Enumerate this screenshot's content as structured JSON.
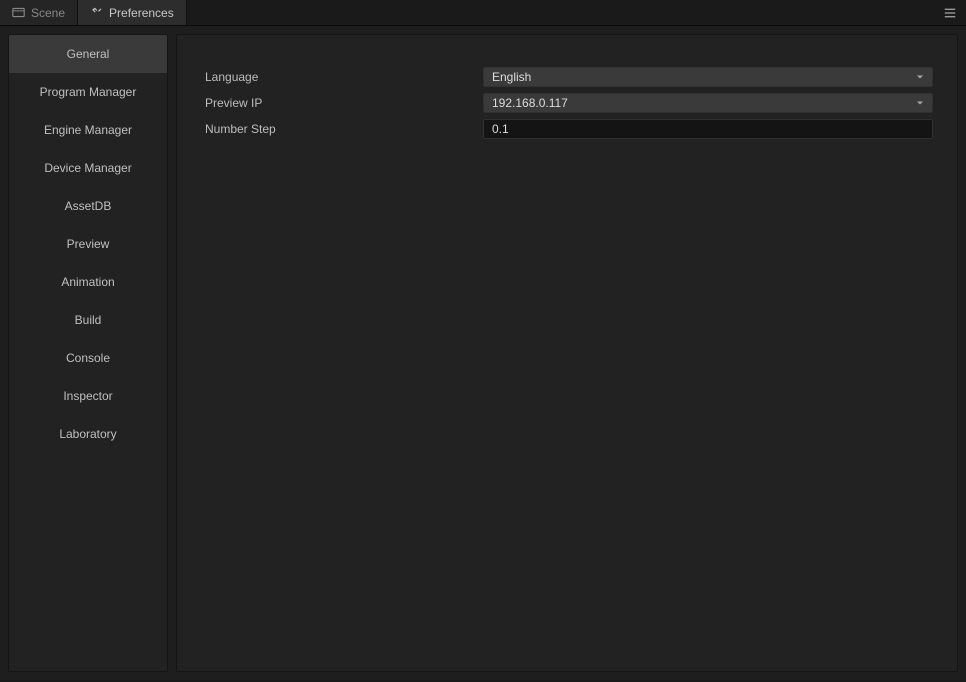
{
  "tabs": {
    "scene": {
      "label": "Scene"
    },
    "preferences": {
      "label": "Preferences"
    }
  },
  "sidebar": {
    "items": [
      {
        "label": "General",
        "selected": true
      },
      {
        "label": "Program Manager"
      },
      {
        "label": "Engine Manager"
      },
      {
        "label": "Device Manager"
      },
      {
        "label": "AssetDB"
      },
      {
        "label": "Preview"
      },
      {
        "label": "Animation"
      },
      {
        "label": "Build"
      },
      {
        "label": "Console"
      },
      {
        "label": "Inspector"
      },
      {
        "label": "Laboratory"
      }
    ]
  },
  "form": {
    "language": {
      "label": "Language",
      "value": "English"
    },
    "preview_ip": {
      "label": "Preview IP",
      "value": "192.168.0.117"
    },
    "number_step": {
      "label": "Number Step",
      "value": "0.1"
    }
  }
}
